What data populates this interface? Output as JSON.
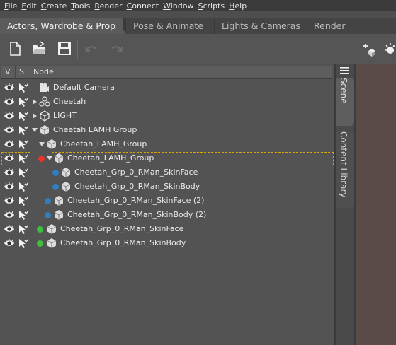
{
  "menu": [
    {
      "key": "F",
      "rest": "ile"
    },
    {
      "key": "E",
      "rest": "dit"
    },
    {
      "key": "C",
      "rest": "reate"
    },
    {
      "key": "T",
      "rest": "ools"
    },
    {
      "key": "R",
      "rest": "ender"
    },
    {
      "key": "C",
      "rest": "onnect"
    },
    {
      "key": "W",
      "rest": "indow"
    },
    {
      "key": "S",
      "rest": "cripts"
    },
    {
      "key": "H",
      "rest": "elp"
    }
  ],
  "tabs": [
    "Actors, Wardrobe & Props",
    "Pose & Animate",
    "Lights & Cameras",
    "Render"
  ],
  "scene": {
    "header": {
      "v": "V",
      "s": "S",
      "node": "Node"
    },
    "rows": [
      {
        "label": "Default Camera",
        "icon": "camera-icon",
        "expander": "none",
        "dot": "",
        "selected": false
      },
      {
        "label": "Cheetah",
        "icon": "figure-icon",
        "expander": "collapsed",
        "dot": "",
        "selected": false
      },
      {
        "label": "LIGHT",
        "icon": "light-icon",
        "expander": "collapsed",
        "dot": "",
        "selected": false
      },
      {
        "label": "Cheetah LAMH Group",
        "icon": "group-icon",
        "expander": "expanded",
        "dot": "",
        "selected": false
      },
      {
        "label": "Cheetah_LAMH_Group",
        "icon": "group-icon",
        "expander": "expanded",
        "dot": "",
        "selected": false
      },
      {
        "label": "Cheetah_LAMH_Group",
        "icon": "group-icon",
        "expander": "expanded",
        "dot": "#e8342c",
        "selected": true
      },
      {
        "label": "Cheetah_Grp_0_RMan_SkinFace",
        "icon": "mesh-icon",
        "expander": "none",
        "dot": "#2f7fc0",
        "selected": false
      },
      {
        "label": "Cheetah_Grp_0_RMan_SkinBody",
        "icon": "mesh-icon",
        "expander": "none",
        "dot": "#2f7fc0",
        "selected": false
      },
      {
        "label": "Cheetah_Grp_0_RMan_SkinFace (2)",
        "icon": "mesh-icon",
        "expander": "none",
        "dot": "#2f7fc0",
        "selected": false
      },
      {
        "label": "Cheetah_Grp_0_RMan_SkinBody (2)",
        "icon": "mesh-icon",
        "expander": "none",
        "dot": "#2f7fc0",
        "selected": false
      },
      {
        "label": "Cheetah_Grp_0_RMan_SkinFace",
        "icon": "mesh-icon",
        "expander": "none",
        "dot": "#3fbf3f",
        "selected": false
      },
      {
        "label": "Cheetah_Grp_0_RMan_SkinBody",
        "icon": "mesh-icon",
        "expander": "none",
        "dot": "#3fbf3f",
        "selected": false
      }
    ]
  },
  "side_tabs": [
    "Scene",
    "Content Library"
  ],
  "toolbar": [
    "new-file-icon",
    "open-folder-icon",
    "save-icon",
    "undo-icon",
    "redo-icon",
    "add-node-icon",
    "light-add-icon"
  ]
}
